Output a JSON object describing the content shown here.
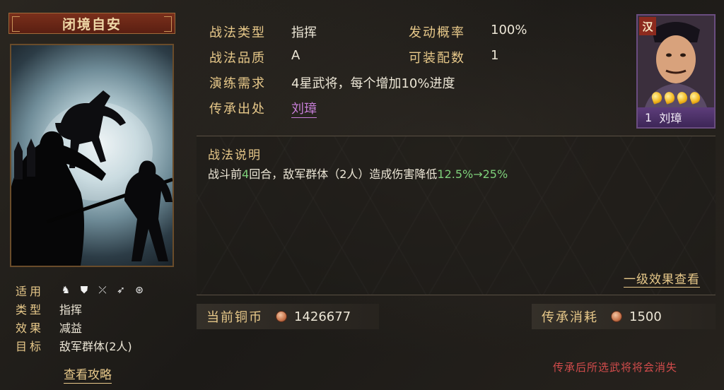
{
  "tactic": {
    "name": "闭境自安"
  },
  "left_meta": {
    "applicable_label": "适用",
    "applicable_icons": [
      "cavalry-icon",
      "shield-icon",
      "bow-icon",
      "spear-icon",
      "wheel-icon"
    ],
    "type_label": "类型",
    "type_value": "指挥",
    "effect_label": "效果",
    "effect_value": "减益",
    "target_label": "目标",
    "target_value": "敌军群体(2人)",
    "guide_link": "查看攻略"
  },
  "info": {
    "tactic_type_label": "战法类型",
    "tactic_type_value": "指挥",
    "trigger_rate_label": "发动概率",
    "trigger_rate_value": "100%",
    "quality_label": "战法品质",
    "quality_value": "A",
    "equip_count_label": "可装配数",
    "equip_count_value": "1",
    "training_label": "演练需求",
    "training_value": "4星武将，每个增加10%进度",
    "inherit_source_label": "传承出处",
    "inherit_source_value": "刘璋"
  },
  "portrait": {
    "faction": "汉",
    "stars": 4,
    "level": "1",
    "name": "刘璋",
    "frame_color": "#6a4d80"
  },
  "description": {
    "title": "战法说明",
    "text_part1": "战斗前",
    "rounds": "4",
    "text_part2": "回合，敌军群体（2人）造成伤害降低",
    "value_range": "12.5%→25%",
    "effect_link": "一级效果查看"
  },
  "currency": {
    "current_label": "当前铜币",
    "current_value": "1426677",
    "cost_label": "传承消耗",
    "cost_value": "1500"
  },
  "warning": "传承后所选武将将会消失",
  "colors": {
    "gold_label": "#e8c98a",
    "highlight_green": "#7ed07a",
    "link_purple": "#c77ed8",
    "warning_red": "#d44c4c",
    "banner_red": "#7a2f1b"
  }
}
